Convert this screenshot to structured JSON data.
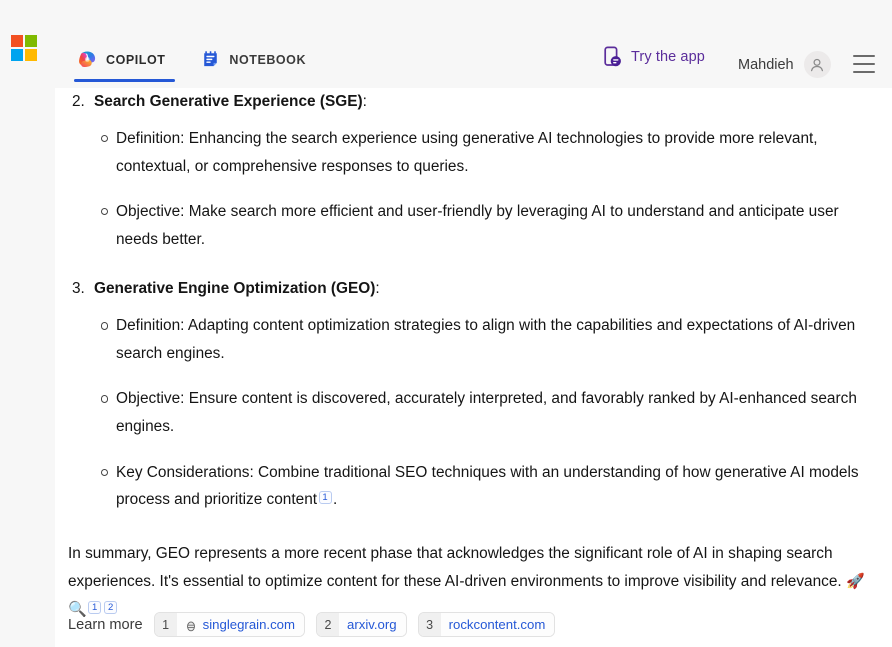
{
  "header": {
    "brand_icon": "microsoft-logo",
    "brand_colors": [
      "#F25022",
      "#7FBA00",
      "#00A4EF",
      "#FFB900"
    ],
    "tabs": [
      {
        "label": "COPILOT",
        "icon": "copilot-swirl-icon",
        "active": true
      },
      {
        "label": "NOTEBOOK",
        "icon": "notebook-icon",
        "active": false
      }
    ],
    "try_app": {
      "label": "Try the app",
      "icon": "phone-chat-icon",
      "color": "#5b2d9b"
    },
    "user": {
      "name": "Mahdieh",
      "avatar_icon": "person-icon"
    },
    "menu_icon": "hamburger-menu-icon",
    "active_tab_underline_color": "#2558d6"
  },
  "main": {
    "sections": [
      {
        "number": "2.",
        "heading": "Search Generative Experience (SGE)",
        "heading_suffix": ":",
        "bullets": [
          "Definition: Enhancing the search experience using generative AI technologies to provide more relevant, contextual, or comprehensive responses to queries.",
          "Objective: Make search more efficient and user-friendly by leveraging AI to understand and anticipate user needs better."
        ]
      },
      {
        "number": "3.",
        "heading": "Generative Engine Optimization (GEO)",
        "heading_suffix": ":",
        "bullets": [
          "Definition: Adapting content optimization strategies to align with the capabilities and expectations of AI-driven search engines.",
          "Objective: Ensure content is discovered, accurately interpreted, and favorably ranked by AI-enhanced search engines."
        ],
        "bullet_with_citation": {
          "text_before": "Key Considerations: Combine traditional SEO techniques with an understanding of how generative AI models process and prioritize content",
          "citation": "1",
          "text_after": "."
        }
      }
    ],
    "summary": {
      "text_before": "In summary, GEO represents a more recent phase that acknowledges the significant role of AI in shaping search experiences. It's essential to optimize content for these AI-driven environments to improve visibility and relevance. ",
      "emojis": "🚀🔍",
      "citations": [
        "1",
        "2"
      ]
    }
  },
  "learn_more": {
    "label": "Learn more",
    "sources": [
      {
        "index": "1",
        "host": "singlegrain.com",
        "favicon": "singlegrain-favicon"
      },
      {
        "index": "2",
        "host": "arxiv.org",
        "favicon": "none"
      },
      {
        "index": "3",
        "host": "rockcontent.com",
        "favicon": "none"
      }
    ],
    "link_color": "#2558d6"
  }
}
